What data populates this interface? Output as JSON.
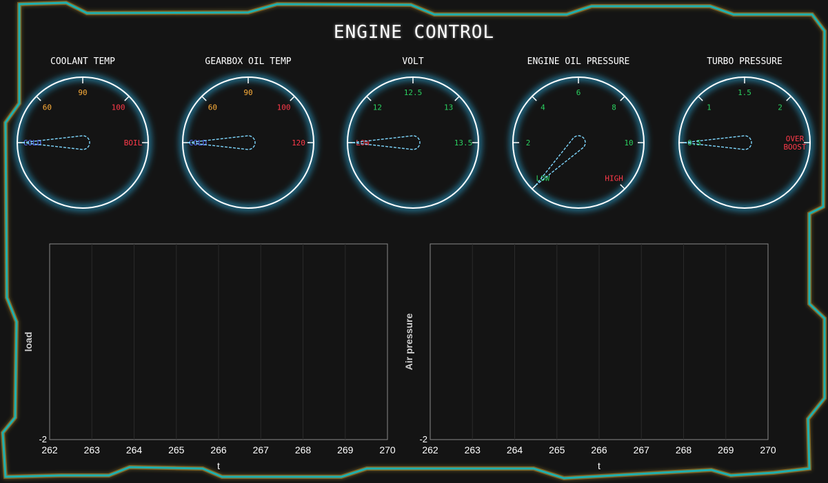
{
  "header": {
    "title": "ENGINE CONTROL"
  },
  "colors": {
    "frame": "#1fb0b0",
    "frame_glow": "#c8a030",
    "gauge_ring": "#ffffff",
    "gauge_glow": "#2aa7d6",
    "needle": "#7fd8ff",
    "cold": "#5c6cff",
    "warm": "#ffb03a",
    "hot": "#ff3a4a",
    "ok": "#2ad060",
    "grid": "#2a2a2a",
    "axis": "#8a8a8a",
    "text": "#ffffff"
  },
  "gauges": [
    {
      "title": "COOLANT TEMP",
      "value_fraction": 0,
      "ticks": [
        {
          "label": "COLD",
          "color_key": "cold"
        },
        {
          "label": "60",
          "color_key": "warm"
        },
        {
          "label": "90",
          "color_key": "warm"
        },
        {
          "label": "100",
          "color_key": "hot"
        },
        {
          "label": "BOIL",
          "color_key": "hot"
        }
      ]
    },
    {
      "title": "GEARBOX OIL TEMP",
      "value_fraction": 0,
      "ticks": [
        {
          "label": "COLD",
          "color_key": "cold"
        },
        {
          "label": "60",
          "color_key": "warm"
        },
        {
          "label": "90",
          "color_key": "warm"
        },
        {
          "label": "100",
          "color_key": "hot"
        },
        {
          "label": "120",
          "color_key": "hot"
        }
      ]
    },
    {
      "title": "VOLT",
      "value_fraction": 0,
      "ticks": [
        {
          "label": "LOW",
          "color_key": "hot"
        },
        {
          "label": "12",
          "color_key": "ok"
        },
        {
          "label": "12.5",
          "color_key": "ok"
        },
        {
          "label": "13",
          "color_key": "ok"
        },
        {
          "label": "13.5",
          "color_key": "ok"
        }
      ]
    },
    {
      "title": "ENGINE OIL PRESSURE",
      "value_fraction": 0,
      "ticks": [
        {
          "label": "LOW",
          "color_key": "ok"
        },
        {
          "label": "2",
          "color_key": "ok"
        },
        {
          "label": "4",
          "color_key": "ok"
        },
        {
          "label": "6",
          "color_key": "ok"
        },
        {
          "label": "8",
          "color_key": "ok"
        },
        {
          "label": "10",
          "color_key": "ok"
        },
        {
          "label": "HIGH",
          "color_key": "hot"
        }
      ]
    },
    {
      "title": "TURBO PRESSURE",
      "value_fraction": 0,
      "ticks": [
        {
          "label": "0.5",
          "color_key": "ok"
        },
        {
          "label": "1",
          "color_key": "ok"
        },
        {
          "label": "1.5",
          "color_key": "ok"
        },
        {
          "label": "2",
          "color_key": "ok"
        },
        {
          "label": "OVER BOOST",
          "color_key": "hot"
        }
      ]
    }
  ],
  "chart_data": [
    {
      "type": "line",
      "xlabel": "t",
      "ylabel": "load",
      "x_ticks": [
        "262",
        "263",
        "264",
        "265",
        "266",
        "267",
        "268",
        "269",
        "270"
      ],
      "y_ticks": [
        "-2"
      ],
      "xlim": [
        262,
        270
      ],
      "grid": true,
      "series": []
    },
    {
      "type": "line",
      "xlabel": "t",
      "ylabel": "Air pressure",
      "x_ticks": [
        "262",
        "263",
        "264",
        "265",
        "266",
        "267",
        "268",
        "269",
        "270"
      ],
      "y_ticks": [
        "-2"
      ],
      "xlim": [
        262,
        270
      ],
      "grid": true,
      "series": []
    }
  ]
}
